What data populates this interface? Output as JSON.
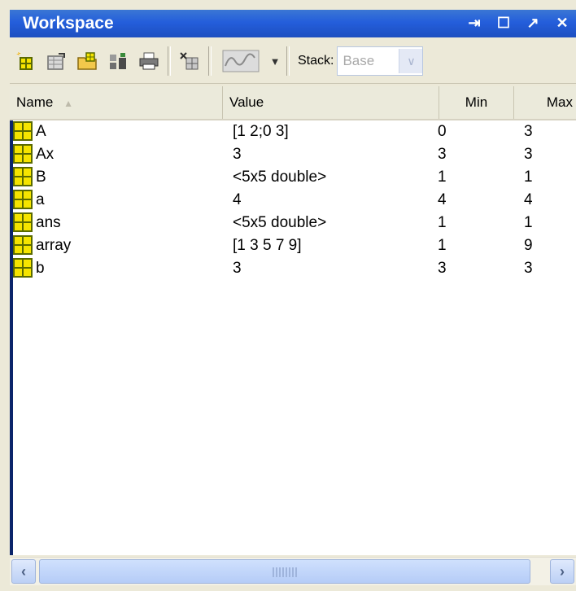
{
  "window": {
    "title": "Workspace"
  },
  "titlebar_icons": [
    "dock-icon",
    "maximize-icon",
    "undock-icon",
    "close-icon"
  ],
  "titlebar_glyphs": [
    "⇥",
    "☐",
    "↗",
    "✕"
  ],
  "toolbar": {
    "icons": [
      "new-variable-icon",
      "open-selection-icon",
      "import-data-icon",
      "save-icon",
      "print-icon",
      "delete-icon",
      "plot-icon"
    ],
    "stack_label": "Stack:",
    "stack_value": "Base"
  },
  "columns": {
    "name": "Name",
    "value": "Value",
    "min": "Min",
    "max": "Max"
  },
  "variables": [
    {
      "name": "A",
      "value": "[1 2;0 3]",
      "min": "0",
      "max": "3"
    },
    {
      "name": "Ax",
      "value": "3",
      "min": "3",
      "max": "3"
    },
    {
      "name": "B",
      "value": "<5x5 double>",
      "min": "1",
      "max": "1"
    },
    {
      "name": "a",
      "value": "4",
      "min": "4",
      "max": "4"
    },
    {
      "name": "ans",
      "value": "<5x5 double>",
      "min": "1",
      "max": "1"
    },
    {
      "name": "array",
      "value": "[1 3 5 7 9]",
      "min": "1",
      "max": "9"
    },
    {
      "name": "b",
      "value": "3",
      "min": "3",
      "max": "3"
    }
  ],
  "colors": {
    "titlebar": "#245edb",
    "selection_border": "#0a246a",
    "variable_icon": "#f5e400"
  }
}
